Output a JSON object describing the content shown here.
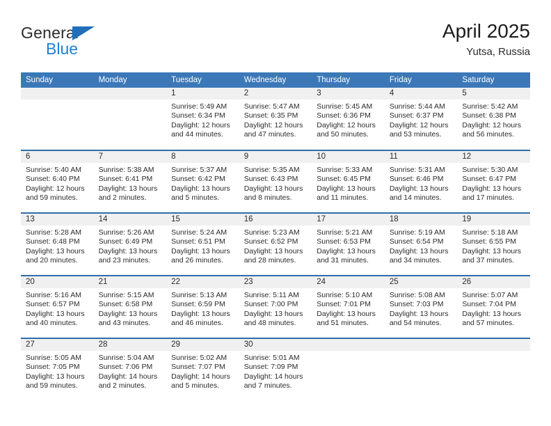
{
  "brand": {
    "name_part1": "General",
    "name_part2": "Blue",
    "triangle_color": "#1f6fba",
    "blue_text_color": "#1f81d6"
  },
  "header": {
    "title": "April 2025",
    "subtitle": "Yutsa, Russia"
  },
  "colors": {
    "header_blue": "#3c78b8",
    "row_divider_blue": "#2e6da8",
    "daynum_band": "#f0f0f0"
  },
  "weekday_headers": [
    "Sunday",
    "Monday",
    "Tuesday",
    "Wednesday",
    "Thursday",
    "Friday",
    "Saturday"
  ],
  "weeks": [
    [
      {
        "day": "",
        "sunrise": "",
        "sunset": "",
        "daylight1": "",
        "daylight2": ""
      },
      {
        "day": "",
        "sunrise": "",
        "sunset": "",
        "daylight1": "",
        "daylight2": ""
      },
      {
        "day": "1",
        "sunrise": "Sunrise: 5:49 AM",
        "sunset": "Sunset: 6:34 PM",
        "daylight1": "Daylight: 12 hours",
        "daylight2": "and 44 minutes."
      },
      {
        "day": "2",
        "sunrise": "Sunrise: 5:47 AM",
        "sunset": "Sunset: 6:35 PM",
        "daylight1": "Daylight: 12 hours",
        "daylight2": "and 47 minutes."
      },
      {
        "day": "3",
        "sunrise": "Sunrise: 5:45 AM",
        "sunset": "Sunset: 6:36 PM",
        "daylight1": "Daylight: 12 hours",
        "daylight2": "and 50 minutes."
      },
      {
        "day": "4",
        "sunrise": "Sunrise: 5:44 AM",
        "sunset": "Sunset: 6:37 PM",
        "daylight1": "Daylight: 12 hours",
        "daylight2": "and 53 minutes."
      },
      {
        "day": "5",
        "sunrise": "Sunrise: 5:42 AM",
        "sunset": "Sunset: 6:38 PM",
        "daylight1": "Daylight: 12 hours",
        "daylight2": "and 56 minutes."
      }
    ],
    [
      {
        "day": "6",
        "sunrise": "Sunrise: 5:40 AM",
        "sunset": "Sunset: 6:40 PM",
        "daylight1": "Daylight: 12 hours",
        "daylight2": "and 59 minutes."
      },
      {
        "day": "7",
        "sunrise": "Sunrise: 5:38 AM",
        "sunset": "Sunset: 6:41 PM",
        "daylight1": "Daylight: 13 hours",
        "daylight2": "and 2 minutes."
      },
      {
        "day": "8",
        "sunrise": "Sunrise: 5:37 AM",
        "sunset": "Sunset: 6:42 PM",
        "daylight1": "Daylight: 13 hours",
        "daylight2": "and 5 minutes."
      },
      {
        "day": "9",
        "sunrise": "Sunrise: 5:35 AM",
        "sunset": "Sunset: 6:43 PM",
        "daylight1": "Daylight: 13 hours",
        "daylight2": "and 8 minutes."
      },
      {
        "day": "10",
        "sunrise": "Sunrise: 5:33 AM",
        "sunset": "Sunset: 6:45 PM",
        "daylight1": "Daylight: 13 hours",
        "daylight2": "and 11 minutes."
      },
      {
        "day": "11",
        "sunrise": "Sunrise: 5:31 AM",
        "sunset": "Sunset: 6:46 PM",
        "daylight1": "Daylight: 13 hours",
        "daylight2": "and 14 minutes."
      },
      {
        "day": "12",
        "sunrise": "Sunrise: 5:30 AM",
        "sunset": "Sunset: 6:47 PM",
        "daylight1": "Daylight: 13 hours",
        "daylight2": "and 17 minutes."
      }
    ],
    [
      {
        "day": "13",
        "sunrise": "Sunrise: 5:28 AM",
        "sunset": "Sunset: 6:48 PM",
        "daylight1": "Daylight: 13 hours",
        "daylight2": "and 20 minutes."
      },
      {
        "day": "14",
        "sunrise": "Sunrise: 5:26 AM",
        "sunset": "Sunset: 6:49 PM",
        "daylight1": "Daylight: 13 hours",
        "daylight2": "and 23 minutes."
      },
      {
        "day": "15",
        "sunrise": "Sunrise: 5:24 AM",
        "sunset": "Sunset: 6:51 PM",
        "daylight1": "Daylight: 13 hours",
        "daylight2": "and 26 minutes."
      },
      {
        "day": "16",
        "sunrise": "Sunrise: 5:23 AM",
        "sunset": "Sunset: 6:52 PM",
        "daylight1": "Daylight: 13 hours",
        "daylight2": "and 28 minutes."
      },
      {
        "day": "17",
        "sunrise": "Sunrise: 5:21 AM",
        "sunset": "Sunset: 6:53 PM",
        "daylight1": "Daylight: 13 hours",
        "daylight2": "and 31 minutes."
      },
      {
        "day": "18",
        "sunrise": "Sunrise: 5:19 AM",
        "sunset": "Sunset: 6:54 PM",
        "daylight1": "Daylight: 13 hours",
        "daylight2": "and 34 minutes."
      },
      {
        "day": "19",
        "sunrise": "Sunrise: 5:18 AM",
        "sunset": "Sunset: 6:55 PM",
        "daylight1": "Daylight: 13 hours",
        "daylight2": "and 37 minutes."
      }
    ],
    [
      {
        "day": "20",
        "sunrise": "Sunrise: 5:16 AM",
        "sunset": "Sunset: 6:57 PM",
        "daylight1": "Daylight: 13 hours",
        "daylight2": "and 40 minutes."
      },
      {
        "day": "21",
        "sunrise": "Sunrise: 5:15 AM",
        "sunset": "Sunset: 6:58 PM",
        "daylight1": "Daylight: 13 hours",
        "daylight2": "and 43 minutes."
      },
      {
        "day": "22",
        "sunrise": "Sunrise: 5:13 AM",
        "sunset": "Sunset: 6:59 PM",
        "daylight1": "Daylight: 13 hours",
        "daylight2": "and 46 minutes."
      },
      {
        "day": "23",
        "sunrise": "Sunrise: 5:11 AM",
        "sunset": "Sunset: 7:00 PM",
        "daylight1": "Daylight: 13 hours",
        "daylight2": "and 48 minutes."
      },
      {
        "day": "24",
        "sunrise": "Sunrise: 5:10 AM",
        "sunset": "Sunset: 7:01 PM",
        "daylight1": "Daylight: 13 hours",
        "daylight2": "and 51 minutes."
      },
      {
        "day": "25",
        "sunrise": "Sunrise: 5:08 AM",
        "sunset": "Sunset: 7:03 PM",
        "daylight1": "Daylight: 13 hours",
        "daylight2": "and 54 minutes."
      },
      {
        "day": "26",
        "sunrise": "Sunrise: 5:07 AM",
        "sunset": "Sunset: 7:04 PM",
        "daylight1": "Daylight: 13 hours",
        "daylight2": "and 57 minutes."
      }
    ],
    [
      {
        "day": "27",
        "sunrise": "Sunrise: 5:05 AM",
        "sunset": "Sunset: 7:05 PM",
        "daylight1": "Daylight: 13 hours",
        "daylight2": "and 59 minutes."
      },
      {
        "day": "28",
        "sunrise": "Sunrise: 5:04 AM",
        "sunset": "Sunset: 7:06 PM",
        "daylight1": "Daylight: 14 hours",
        "daylight2": "and 2 minutes."
      },
      {
        "day": "29",
        "sunrise": "Sunrise: 5:02 AM",
        "sunset": "Sunset: 7:07 PM",
        "daylight1": "Daylight: 14 hours",
        "daylight2": "and 5 minutes."
      },
      {
        "day": "30",
        "sunrise": "Sunrise: 5:01 AM",
        "sunset": "Sunset: 7:09 PM",
        "daylight1": "Daylight: 14 hours",
        "daylight2": "and 7 minutes."
      },
      {
        "day": "",
        "sunrise": "",
        "sunset": "",
        "daylight1": "",
        "daylight2": ""
      },
      {
        "day": "",
        "sunrise": "",
        "sunset": "",
        "daylight1": "",
        "daylight2": ""
      },
      {
        "day": "",
        "sunrise": "",
        "sunset": "",
        "daylight1": "",
        "daylight2": ""
      }
    ]
  ]
}
